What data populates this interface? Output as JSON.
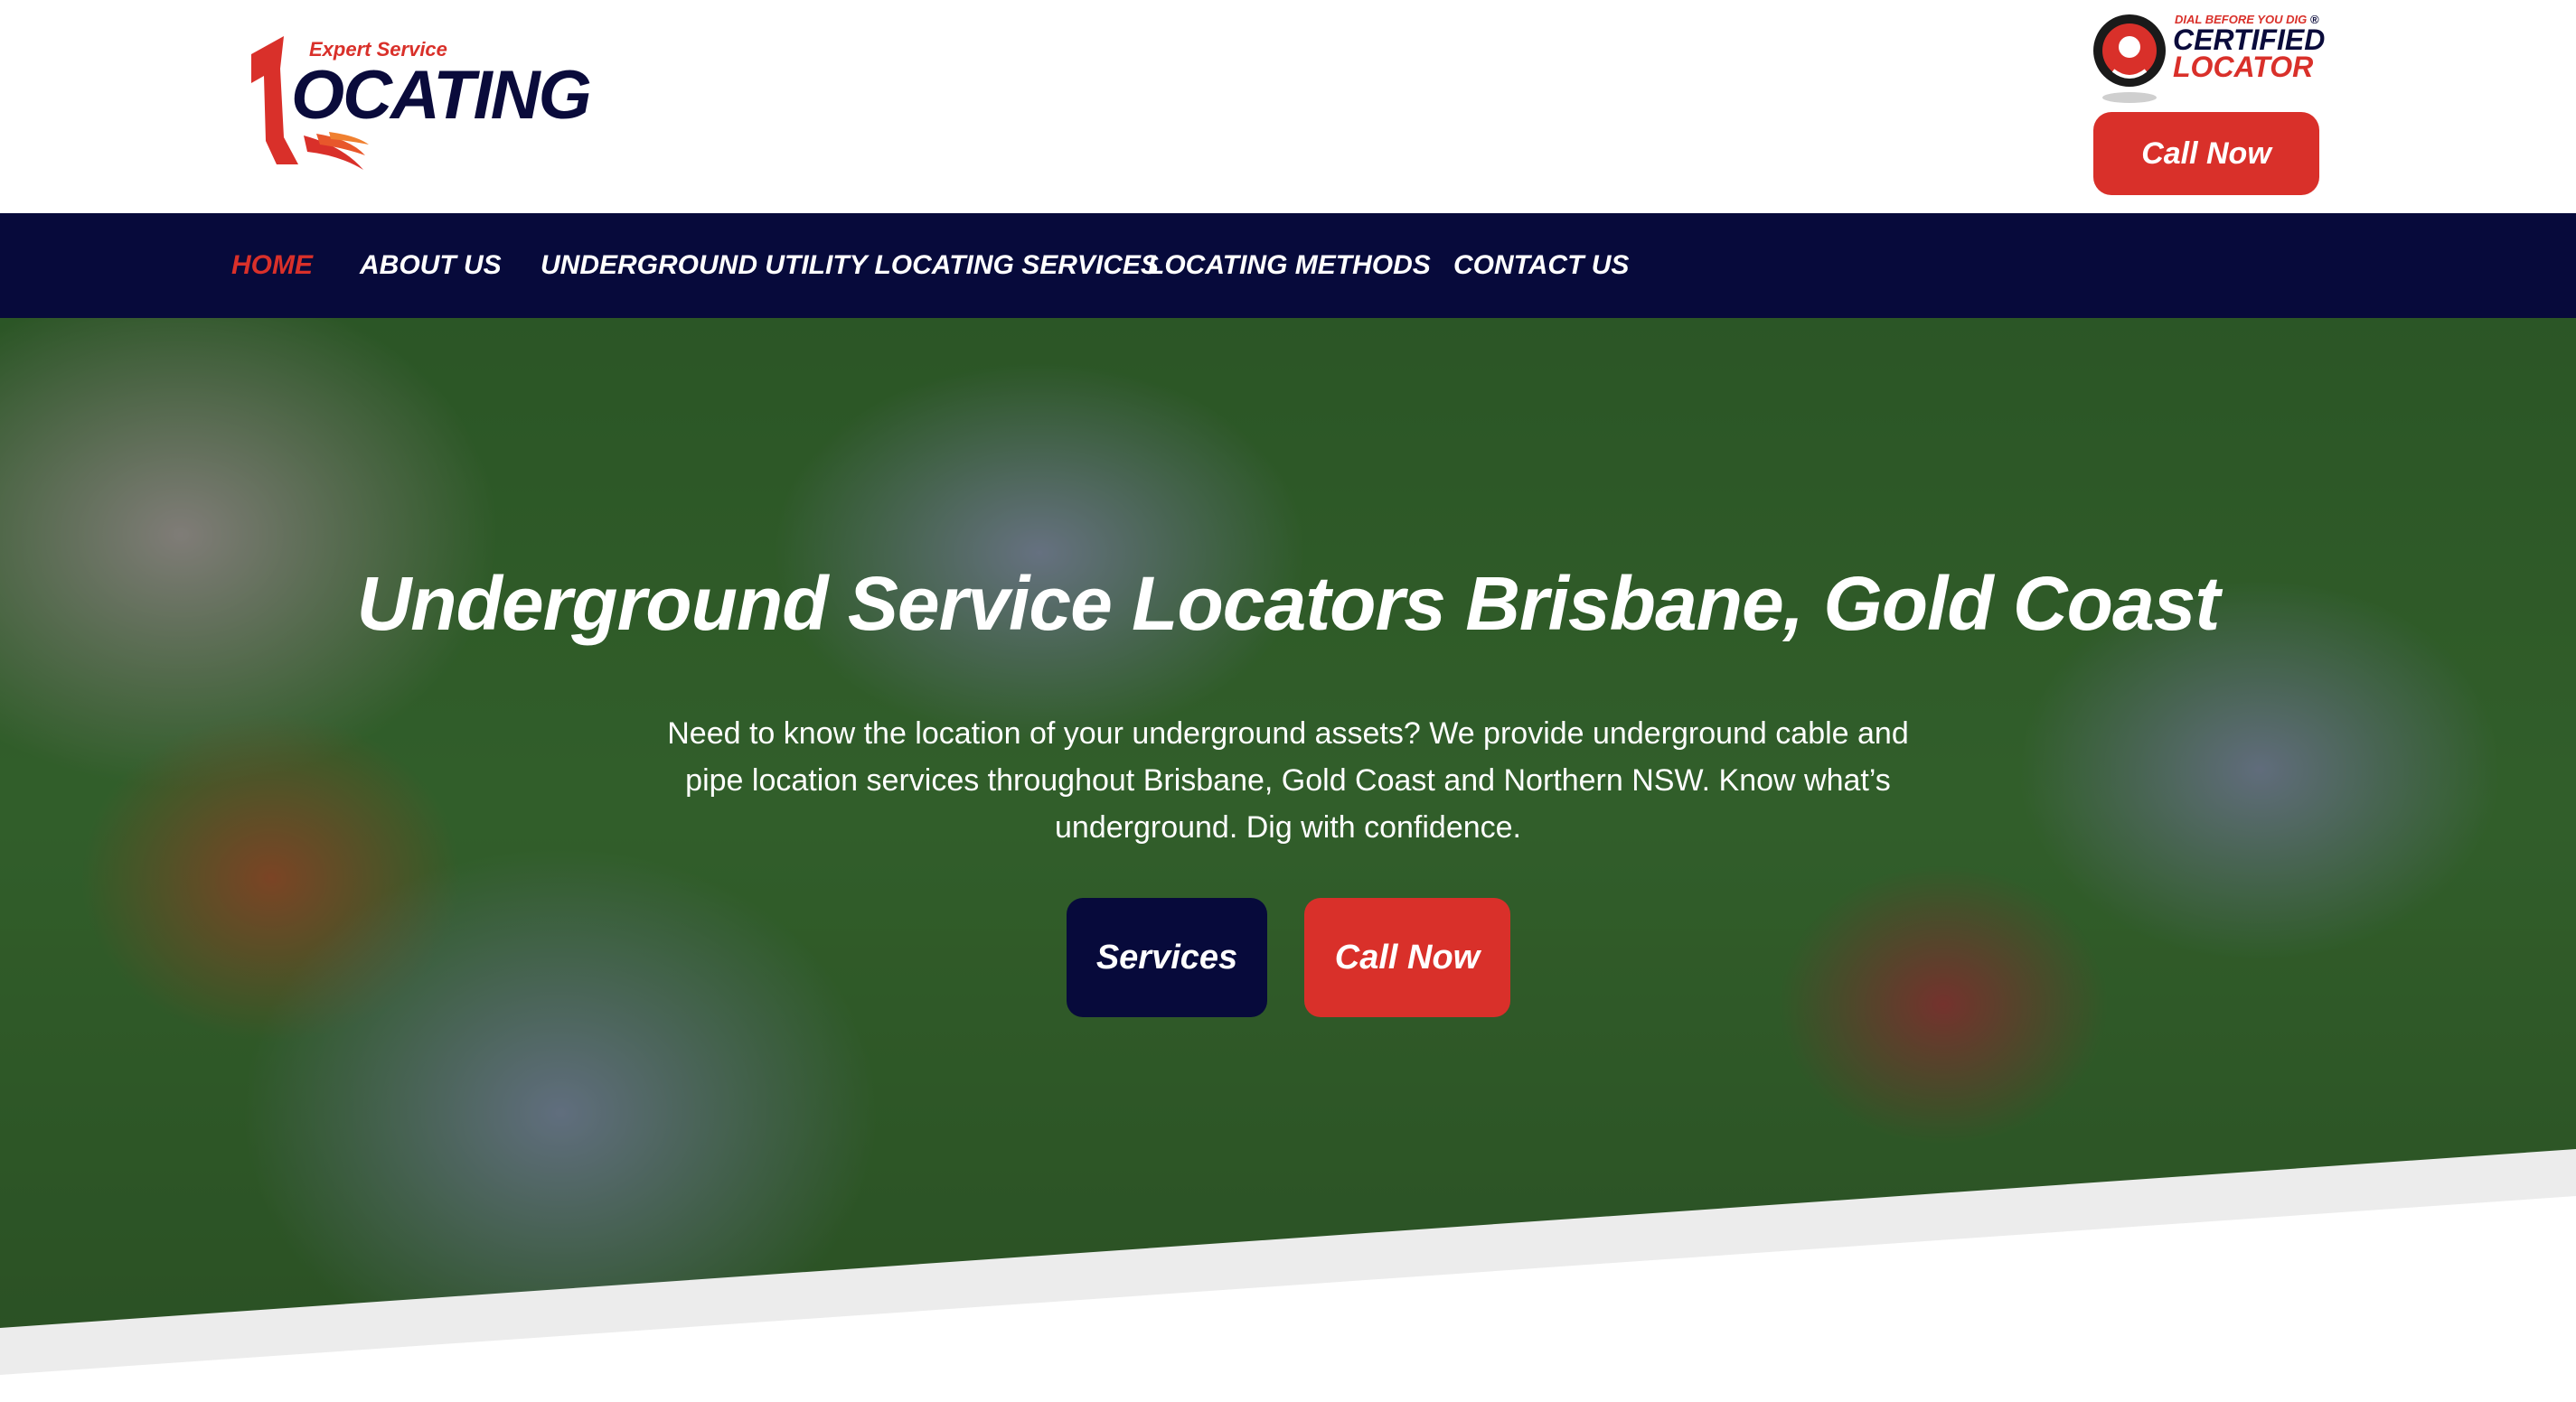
{
  "logo": {
    "expert": "Expert",
    "service": "Service",
    "wordmark": "OCATING",
    "mark": "L"
  },
  "certified": {
    "dial": "DIAL",
    "before_you_dig": "BEFORE YOU DIG",
    "registered": "®",
    "line1": "CERTIFIED",
    "line2": "LOCATOR"
  },
  "header": {
    "call_now": "Call Now"
  },
  "nav": {
    "items": [
      {
        "label": "HOME",
        "active": true
      },
      {
        "label": "ABOUT US",
        "active": false
      },
      {
        "label": "UNDERGROUND UTILITY LOCATING SERVICES",
        "active": false
      },
      {
        "label": "LOCATING METHODS",
        "active": false
      },
      {
        "label": "CONTACT US",
        "active": false
      }
    ]
  },
  "hero": {
    "title": "Underground Service Locators Brisbane, Gold Coast",
    "text": "Need to know the location of your underground assets? We provide underground cable and pipe location services throughout Brisbane, Gold Coast and Northern NSW. Know what’s underground. Dig with confidence.",
    "services_button": "Services",
    "call_button": "Call Now"
  },
  "colors": {
    "brand_navy": "#070a3b",
    "brand_red": "#d9302a"
  },
  "icons": {
    "cert_badge": "dial-before-you-dig-badge-icon",
    "logo_swoosh": "logo-swoosh-icon"
  }
}
